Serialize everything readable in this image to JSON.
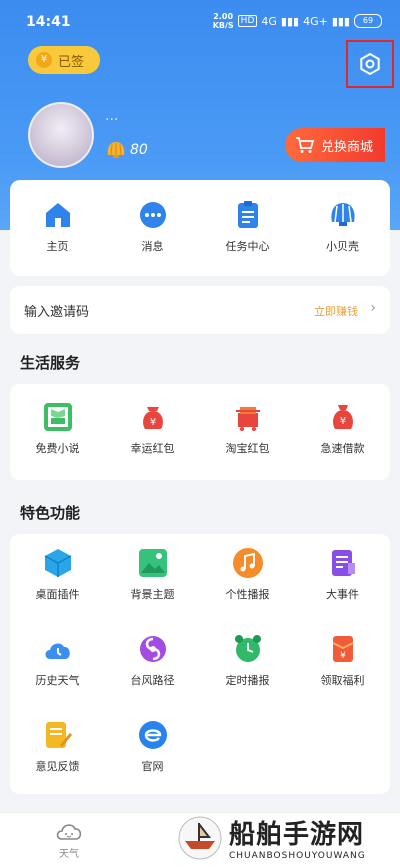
{
  "status_bar": {
    "time": "14:41",
    "net_speed": "2.00",
    "net_unit": "KB/S",
    "hd": "HD",
    "net1": "4G",
    "net2": "4G+",
    "battery": "69"
  },
  "header": {
    "signed_label": "已签",
    "username": "...",
    "shell_count": "80",
    "mall_label": "兑换商城"
  },
  "nav": {
    "items": [
      {
        "label": "主页",
        "icon": "home-icon"
      },
      {
        "label": "消息",
        "icon": "message-icon"
      },
      {
        "label": "任务中心",
        "icon": "task-icon"
      },
      {
        "label": "小贝壳",
        "icon": "shell-icon"
      }
    ]
  },
  "invite": {
    "label": "输入邀请码",
    "action": "立即赚钱"
  },
  "life": {
    "title": "生活服务",
    "items": [
      {
        "label": "免费小说",
        "icon": "novel-icon"
      },
      {
        "label": "幸运红包",
        "icon": "red-packet-icon"
      },
      {
        "label": "淘宝红包",
        "icon": "taobao-icon"
      },
      {
        "label": "急速借款",
        "icon": "loan-icon"
      }
    ]
  },
  "features": {
    "title": "特色功能",
    "items": [
      {
        "label": "桌面插件",
        "icon": "widget-icon"
      },
      {
        "label": "背景主题",
        "icon": "theme-icon"
      },
      {
        "label": "个性播报",
        "icon": "music-icon"
      },
      {
        "label": "大事件",
        "icon": "event-icon"
      },
      {
        "label": "历史天气",
        "icon": "history-weather-icon"
      },
      {
        "label": "台风路径",
        "icon": "typhoon-icon"
      },
      {
        "label": "定时播报",
        "icon": "alarm-icon"
      },
      {
        "label": "领取福利",
        "icon": "welfare-icon"
      },
      {
        "label": "意见反馈",
        "icon": "feedback-icon"
      },
      {
        "label": "官网",
        "icon": "website-icon"
      }
    ]
  },
  "bottom_nav": {
    "weather_label": "天气"
  },
  "watermark": {
    "title": "船舶手游网",
    "sub": "CHUANBOSHOUYOUWANG"
  },
  "colors": {
    "header_blue": "#3c8cf0",
    "accent_orange": "#f43a2d",
    "gold": "#f8c93a"
  }
}
